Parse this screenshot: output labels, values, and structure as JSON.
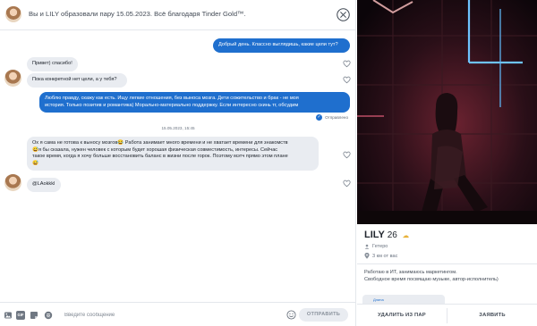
{
  "header": {
    "title": "Вы и LILY образовали пару 15.05.2023. Всё благодаря Tinder Gold™."
  },
  "messages": [
    {
      "from": "me",
      "text": "Добрый день. Классно выглядишь, какие цели тут?"
    },
    {
      "from": "her",
      "text": "Привет) спасибо!"
    },
    {
      "from": "her",
      "text": "Пока конкретной нет цели, а у тебя?"
    },
    {
      "from": "me",
      "lines": [
        "Люблю правду, скажу как есть. Ищу легкие отношения, без выноса мозга. Дети сожительство и брак - не моя",
        "история. Только позитив и романтика) Морально-материально поддержку. Если интересно скинь тг, обсудим"
      ]
    },
    {
      "from": "her",
      "lines": [
        "Ох я сама не готова к выносу мозгов😂 Работа занимает много времени и не хватает времени для знакомств",
        "😅я бы сказала, нужен человек с которым будет хорошая физическая совместимость, интересы. Сейчас",
        "такое время, когда я хочу больше восстановить баланс в жизни после горок. Поэтому мэтч прямо этом плане",
        "😅"
      ]
    },
    {
      "from": "her",
      "text": "@LAokkkl"
    }
  ],
  "status": {
    "sent_label": "Отправлено",
    "check": "✓"
  },
  "timestamp": "15.05.2023, 15:45",
  "composer": {
    "placeholder": "Введите сообщение",
    "send_label": "ОТПРАВИТЬ",
    "icons": [
      "gallery-icon",
      "gif-icon",
      "sticker-icon",
      "music-icon",
      "emoji-icon"
    ],
    "gif_label": "GIF"
  },
  "profile": {
    "name": "LILY",
    "age": "26",
    "orientation": "Гетеро",
    "distance": "3 км от вас",
    "bio": [
      "Работаю в ИТ, занимаюсь маркетингом.",
      "Свободное время посвящаю музыке, автор-исполнитель)"
    ],
    "card_label": "Длина",
    "unmatch_label": "УДАЛИТЬ ИЗ ПАР",
    "report_label": "ЗАЯВИТЬ"
  },
  "colors": {
    "accent_blue": "#1f6fce",
    "incoming_bubble": "#e9ecf1",
    "text_dark": "#21262e",
    "gold": "#e8b23a"
  }
}
